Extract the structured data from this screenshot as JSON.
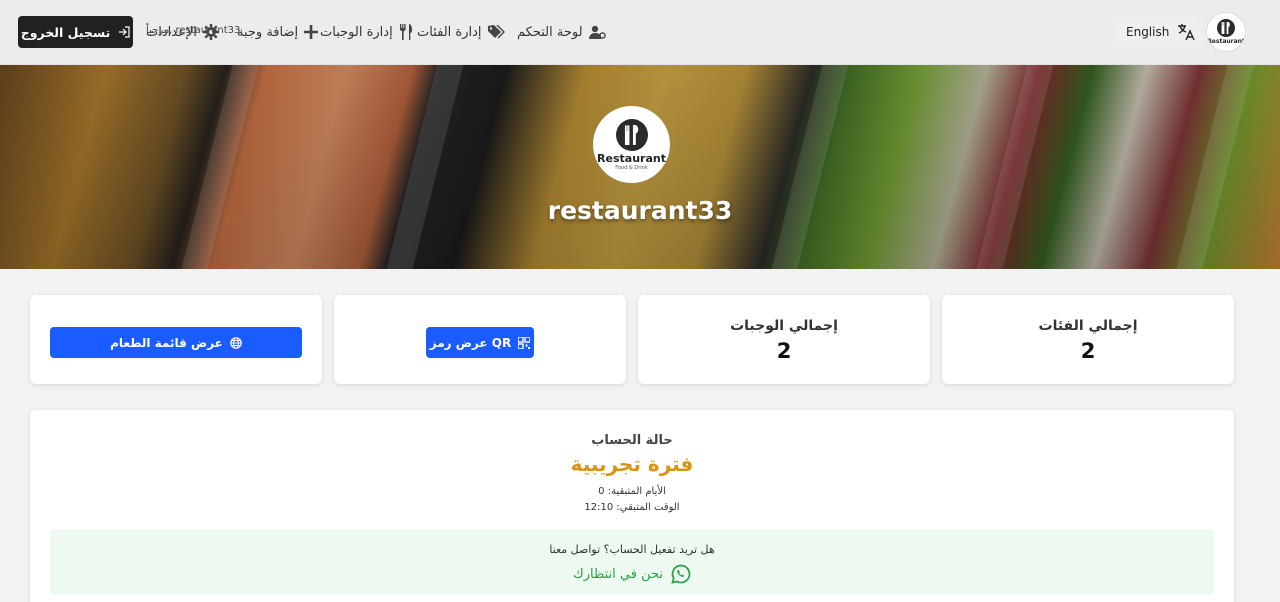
{
  "header": {
    "logo": {
      "text": "Restaurant",
      "icon": "fork-knife-icon"
    },
    "language_label": "English",
    "nav": {
      "dashboard": "لوحة التحكم",
      "categories": "إدارة الفئات",
      "meals": "إدارة الوجبات",
      "add_meal": "إضافة وجبة",
      "settings": "الإعدادات"
    },
    "welcome": "مرحباً, restaurant33",
    "logout_label": "تسجيل الخروج"
  },
  "hero": {
    "logo_text": "Restaurant",
    "logo_sub": "Food & Drink",
    "restaurant_name": "restaurant33"
  },
  "stats": {
    "total_categories_label": "إجمالي الفئات",
    "total_categories_value": "2",
    "total_meals_label": "إجمالي الوجبات",
    "total_meals_value": "2",
    "qr_button_label": "عرض رمز QR",
    "menu_button_label": "عرض قائمة الطعام"
  },
  "account": {
    "status_title": "حالة الحساب",
    "status_value": "فترة تجريبية",
    "days_remaining": "الأيام المتبقية: 0",
    "time_remaining": "الوقت المتبقي: 12:10",
    "activate_question": "هل تريد تفعيل الحساب؟ تواصل معنا",
    "whatsapp_label": "نحن في انتظارك"
  },
  "colors": {
    "primary_button": "#1a5cff",
    "trial_status": "#d89413",
    "whatsapp": "#25a244",
    "logout_button": "#212121"
  }
}
